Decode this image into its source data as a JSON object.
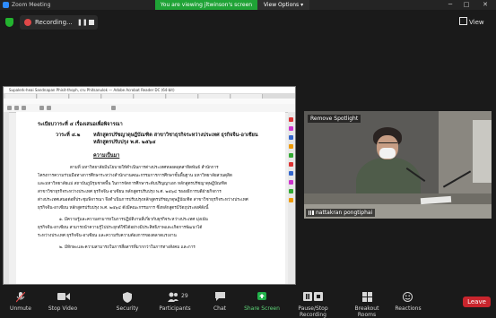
{
  "window": {
    "title": "Zoom Meeting",
    "controls": {
      "minimize": "─",
      "maximize": "□",
      "close": "✕"
    }
  },
  "banner": {
    "viewing_text": "You are viewing jltwinson's screen",
    "view_options": "View Options ▾"
  },
  "recording": {
    "label": "Recording...",
    "pause": "❚❚"
  },
  "view": {
    "label": "View"
  },
  "shared_window": {
    "title": "Supalerk-heai Sandnapan Phisit-thoph, cru Phitsanulok — Adobe Acrobat Reader DC (64-bit)",
    "document": {
      "heading": "ระเบียบวาระที่  ๔  เรื่องเสนอเพื่อพิจารณา",
      "item_label": "วาระที่  ๔.๒",
      "item_title_1": "หลักสูตรปรัชญาดุษฎีบัณฑิต สาขาวิชาธุรกิจระหว่างประเทศ ธุรกิจจีน-อาเซียน",
      "item_title_2": "หลักสูตรปรับปรุง พ.ศ. ๒๕๖๔",
      "section": "ความเป็นมา",
      "para_1": "ตามที่ มหาวิทยาลัยมีนโยบายให้ดำเนินการต่างประเทศหลอดอุตสาหิดพันธ์ สำนักการ",
      "para_2": "โครงการความร่วมมือทางการศึกษาระหว่างสำนักงานคณะกรรมการการศึกษาขั้นพื้นฐาน มหาวิทยาลัยสวนดุสิต",
      "para_3": "และมหาวิทยาลัยแม่ สถาบันภูมิรุมชาตพื้น ในการจัดการศึกษาระดับปริญญาเอก หลักสูตรปรัชญาดุษฎีบัณฑิต",
      "para_4": "สาขาวิชาธุรกิจระหว่างประเทศ ธุรกิจจีน-อาเซียน หลักสูตรปรับปรุง พ.ศ. ๒๕๖๔ รองอธิการบดีฝ่ายกิจการ",
      "para_5": "ต่างประเทศเสนอต่อที่ประชุมพิจารณา จึงดำเนินการปรับปรุงหลักสูตรปรัชญาดุษฎีบัณฑิต สาขาวิชาธุรกิจระหว่างประเทศ",
      "para_6": "ธุรกิจจีน-อาเซียน หลักสูตรปรับปรุง พ.ศ. ๒๕๖๔ ดังมีคณะกรรมการ ซึ่งหลักสูตรมีวัตถุประสงค์ดังนี้",
      "bullet_1": "๑. มีความรู้และความสามารถในการปฏิบัติงานที่เกี่ยวกับธุรกิจระหว่างประเทศ มุ่งเน้น",
      "bullet_1b": "ธุรกิจจีน-อาเซียน สามารถนำความรู้ไปประยุกต์ใช้ได้อย่างมีประสิทธิภาพและเกิดการพัฒนาได้",
      "bullet_1c": "ระหว่างประเทศ ธุรกิจจีน-อาเซียน และความรับความต้องการของตลาดแรงงาน",
      "bullet_2": "๒. มีทักษะและความสามารถในการสื่อสารที่มากกว่าในการทางสังคม และการ"
    }
  },
  "video": {
    "remove_spotlight": "Remove Spotlight",
    "participant_name": "nattakran pongtiphai"
  },
  "toolbar": {
    "unmute": "Unmute",
    "stop_video": "Stop Video",
    "security": "Security",
    "participants": "Participants",
    "participants_count": "29",
    "chat": "Chat",
    "share_screen": "Share Screen",
    "record": "Pause/Stop Recording",
    "breakout": "Breakout Rooms",
    "reactions": "Reactions",
    "leave": "Leave"
  },
  "colors": {
    "accent_green": "#1fa336",
    "leave_red": "#c9252d",
    "recording_red": "#e04848"
  }
}
